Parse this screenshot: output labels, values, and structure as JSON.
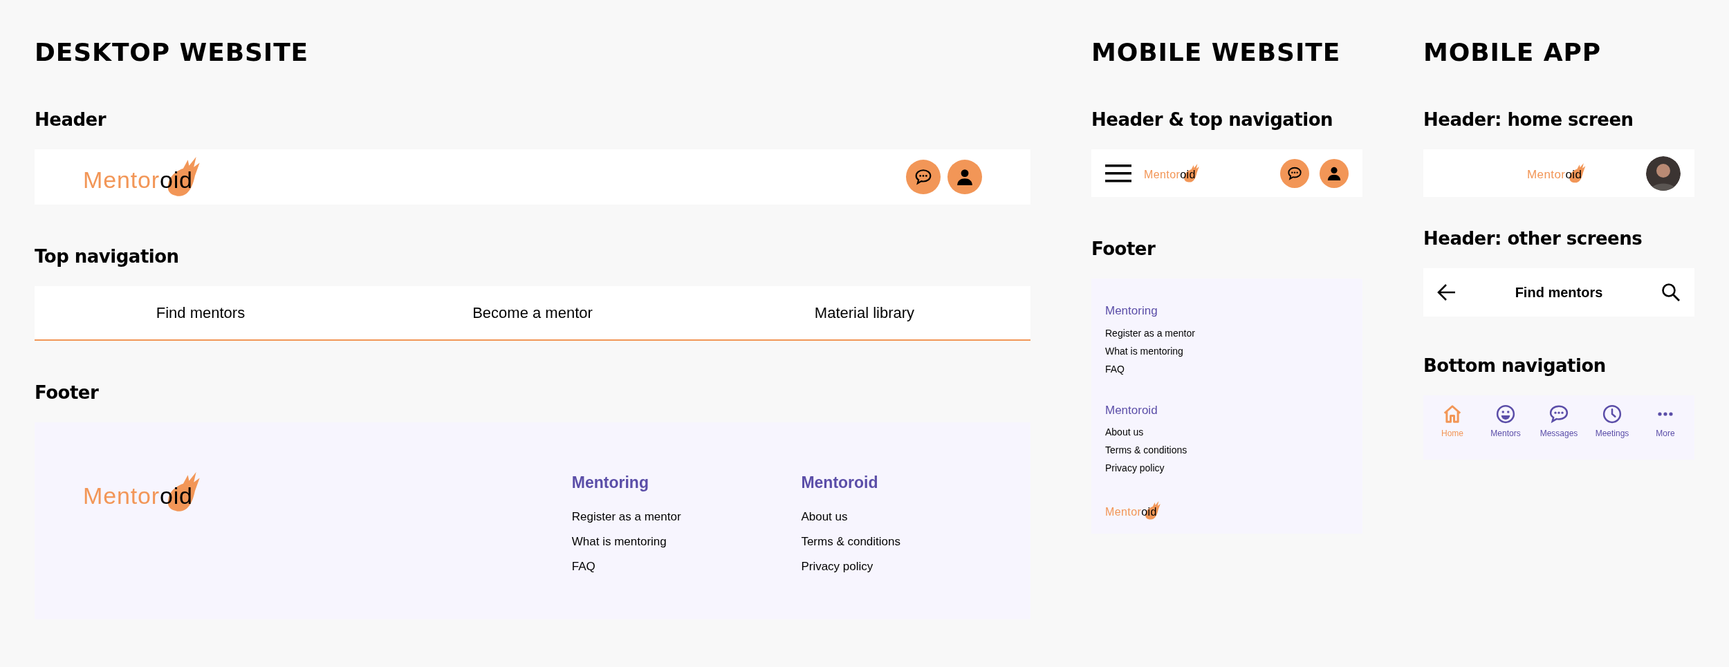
{
  "desktop": {
    "title": "DESKTOP WEBSITE",
    "header": {
      "title": "Header",
      "logo": [
        "Mentor",
        "oid"
      ]
    },
    "top_navigation": {
      "title": "Top navigation",
      "items": [
        "Find mentors",
        "Become a mentor",
        "Material library"
      ]
    },
    "footer": {
      "title": "Footer",
      "logo": [
        "Mentor",
        "oid"
      ],
      "columns": [
        {
          "heading": "Mentoring",
          "links": [
            "Register as a mentor",
            "What is mentoring",
            "FAQ"
          ]
        },
        {
          "heading": "Mentoroid",
          "links": [
            "About us",
            "Terms & conditions",
            "Privacy policy"
          ]
        }
      ]
    }
  },
  "mobile_website": {
    "title": "MOBILE WEBSITE",
    "header": {
      "title": "Header & top navigation",
      "logo": [
        "Mentor",
        "oid"
      ]
    },
    "footer": {
      "title": "Footer",
      "logo": [
        "Mentor",
        "oid"
      ],
      "columns": [
        {
          "heading": "Mentoring",
          "links": [
            "Register as a mentor",
            "What is mentoring",
            "FAQ"
          ]
        },
        {
          "heading": "Mentoroid",
          "links": [
            "About us",
            "Terms & conditions",
            "Privacy policy"
          ]
        }
      ]
    }
  },
  "mobile_app": {
    "title": "MOBILE APP",
    "home_header": {
      "title": "Header: home screen",
      "logo": [
        "Mentor",
        "oid"
      ]
    },
    "other_header": {
      "title": "Header: other screens",
      "screen_title": "Find mentors"
    },
    "bottom_navigation": {
      "title": "Bottom navigation",
      "items": [
        {
          "kind": "home",
          "label": "Home",
          "selected": true
        },
        {
          "kind": "mentors",
          "label": "Mentors",
          "selected": false
        },
        {
          "kind": "messages",
          "label": "Messages",
          "selected": false
        },
        {
          "kind": "meetings",
          "label": "Meetings",
          "selected": false
        },
        {
          "kind": "more",
          "label": "More",
          "selected": false
        }
      ]
    }
  }
}
